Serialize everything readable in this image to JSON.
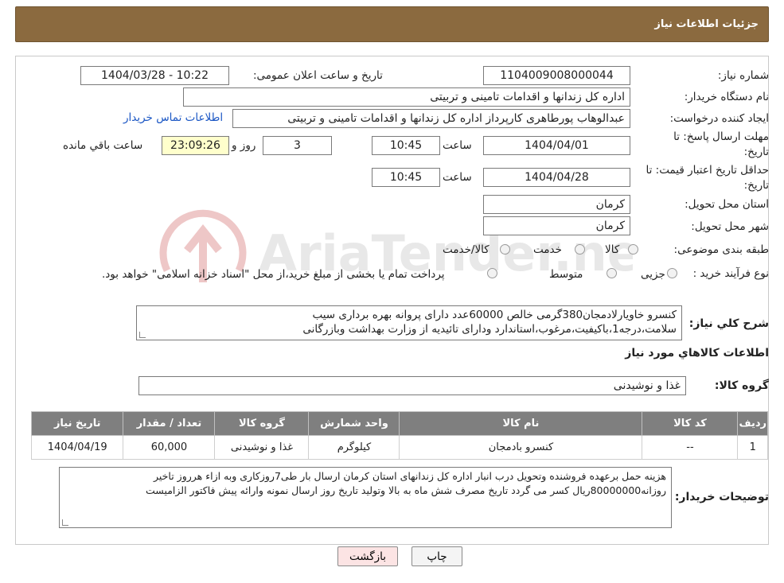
{
  "header": {
    "title": "جزئیات اطلاعات نیاز"
  },
  "form": {
    "need_number_label": "شماره نیاز:",
    "need_number": "1104009008000044",
    "announce_label": "تاریخ و ساعت اعلان عمومی:",
    "announce_value": "1404/03/28 - 10:22",
    "buyer_org_label": "نام دستگاه خریدار:",
    "buyer_org": "اداره کل زندانها و اقدامات تامینی و تربیتی",
    "creator_label": "ایجاد کننده درخواست:",
    "creator": "عبدالوهاب پورطاهری کارپرداز اداره کل زندانها و اقدامات تامینی و تربیتی",
    "contact_link": "اطلاعات تماس خریدار",
    "deadline_label_1": "مهلت ارسال پاسخ: تا",
    "deadline_label_2": "تاریخ:",
    "deadline_date": "1404/04/01",
    "time_label": "ساعت",
    "deadline_time": "10:45",
    "days_value": "3",
    "days_label": "روز و",
    "remaining_time": "23:09:26",
    "remaining_label": "ساعت باقي مانده",
    "validity_label_1": "حداقل تاریخ اعتبار قیمت: تا",
    "validity_label_2": "تاریخ:",
    "validity_date": "1404/04/28",
    "validity_time": "10:45",
    "province_label": "استان محل تحویل:",
    "province": "کرمان",
    "city_label": "شهر محل تحویل:",
    "city": "کرمان",
    "category_label": "طبقه بندی موضوعی:",
    "category_options": [
      "کالا",
      "خدمت",
      "کالا/خدمت"
    ],
    "process_label": "نوع فرآیند خرید :",
    "process_options": [
      "جزیی",
      "متوسط"
    ],
    "process_note": "پرداخت تمام یا بخشی از مبلغ خرید،از محل \"اسناد خزانه اسلامی\" خواهد بود."
  },
  "description": {
    "label": "شرح کلي نياز:",
    "line1": "کنسرو خاویارلادمجان380گرمی خالص 60000عدد دارای پروانه بهره برداری سیب",
    "line2": "سلامت،درجه1،باکیفیت،مرغوب،استاندارد ودارای تائیدیه از وزارت بهداشت وبازرگانی"
  },
  "goods_section": {
    "title": "اطلاعات کالاهاي مورد نياز",
    "group_label": "گروه کالا:",
    "group_value": "غذا و نوشیدنی"
  },
  "table": {
    "headers": [
      "ردیف",
      "کد کالا",
      "نام کالا",
      "واحد شمارش",
      "گروه کالا",
      "تعداد / مقدار",
      "تاریخ نیاز"
    ],
    "rows": [
      [
        "1",
        "--",
        "کنسرو بادمجان",
        "کیلوگرم",
        "غذا و نوشیدنی",
        "60,000",
        "1404/04/19"
      ]
    ]
  },
  "buyer_notes": {
    "label": "توضیحات خریدار:",
    "line1": "هزینه حمل برعهده فروشنده وتحویل درب انبار اداره کل زندانهای استان کرمان ارسال بار طی7روزکاری وبه ازاء هرروز تاخیر",
    "line2": "روزانه80000000ریال کسر می گردد تاریخ مصرف شش ماه به بالا وتولید تاریخ روز ارسال نمونه وارائه پیش فاکتور الزامیست"
  },
  "buttons": {
    "print": "چاپ",
    "back": "بازگشت"
  },
  "watermark": {
    "text": "AriaTender.neT"
  },
  "colors": {
    "header_bg": "#8b6a3f",
    "table_header_bg": "#7f7f7f",
    "link": "#1a56c4",
    "remaining_bg": "#ffffcc"
  }
}
